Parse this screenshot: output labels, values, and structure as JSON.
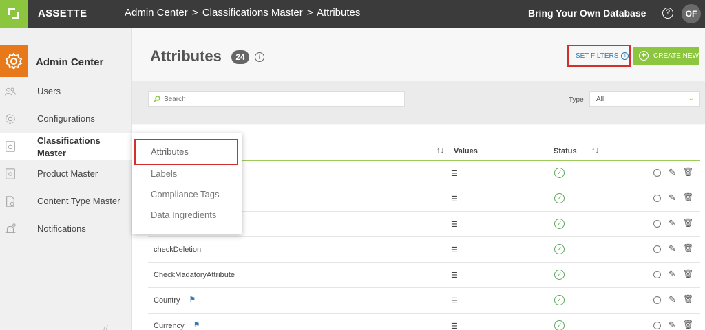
{
  "topbar": {
    "brand": "ASSETTE",
    "breadcrumb": [
      "Admin Center",
      "Classifications Master",
      "Attributes"
    ],
    "separator": ">",
    "byod": "Bring Your Own Database",
    "help": "?",
    "avatar": "OF"
  },
  "sidebar": {
    "title": "Admin Center",
    "items": [
      {
        "label": "Users",
        "icon": "users-icon"
      },
      {
        "label": "Configurations",
        "icon": "gear-icon"
      },
      {
        "label": "Classifications Master",
        "icon": "classification-icon"
      },
      {
        "label": "Product Master",
        "icon": "product-icon"
      },
      {
        "label": "Content Type Master",
        "icon": "document-icon"
      },
      {
        "label": "Notifications",
        "icon": "bell-icon"
      }
    ]
  },
  "flyout": {
    "items": [
      "Attributes",
      "Labels",
      "Compliance Tags",
      "Data Ingredients"
    ]
  },
  "main": {
    "title": "Attributes",
    "count": "24",
    "set_filters": "SET FILTERS",
    "create_new": "CREATE NEW",
    "search_placeholder": "Search",
    "type_label": "Type",
    "type_value": "All",
    "columns": {
      "values": "Values",
      "status": "Status"
    },
    "rows": [
      {
        "name": "",
        "tag": false
      },
      {
        "name": "",
        "tag": false
      },
      {
        "name": "",
        "tag": false
      },
      {
        "name": "checkDeletion",
        "tag": false
      },
      {
        "name": "CheckMadatoryAttribute",
        "tag": false
      },
      {
        "name": "Country",
        "tag": true
      },
      {
        "name": "Currency",
        "tag": true
      }
    ]
  },
  "colors": {
    "accent": "#8cc63f",
    "orange": "#e8791a",
    "topbar": "#3b3b3b",
    "highlight": "#d32f2f"
  }
}
